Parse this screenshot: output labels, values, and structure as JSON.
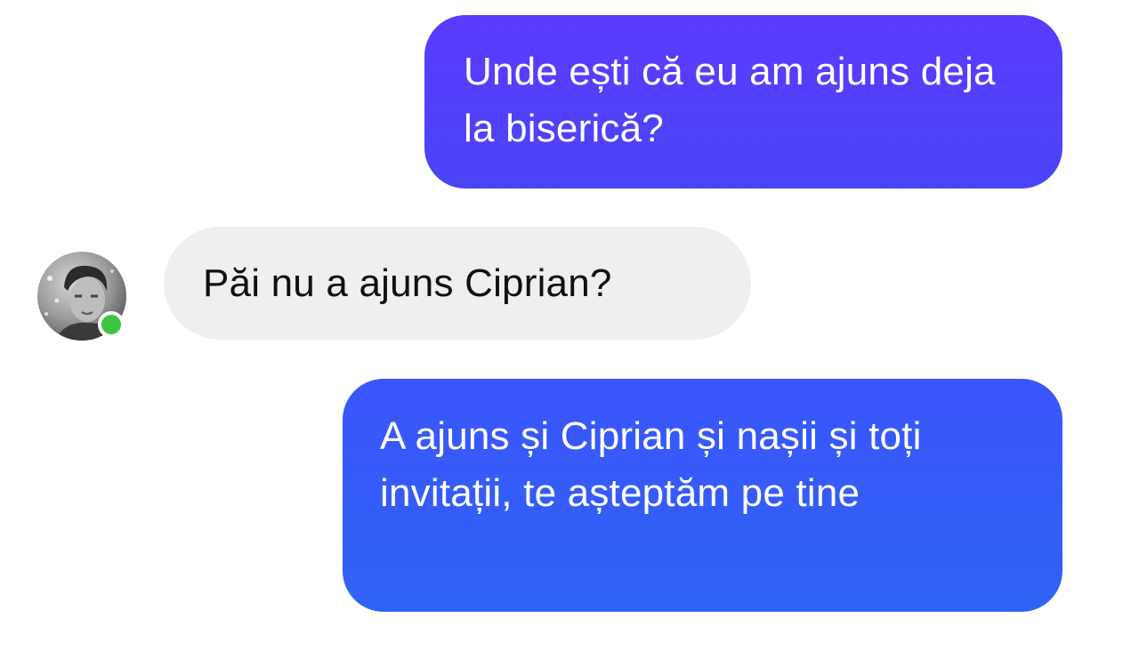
{
  "conversation": {
    "messages": [
      {
        "direction": "outgoing",
        "text": "Unde ești că eu am ajuns deja la biserică?"
      },
      {
        "direction": "incoming",
        "text": "Păi nu a ajuns Ciprian?"
      },
      {
        "direction": "outgoing",
        "text": "A ajuns și Ciprian și nașii și toți invitații, te așteptăm pe tine"
      }
    ],
    "contact": {
      "avatar_icon": "user-photo",
      "status": "online",
      "status_color": "#3ec53e"
    }
  },
  "colors": {
    "outgoing_bubble_top": "#5a3bff",
    "outgoing_bubble_bottom": "#2f63f6",
    "incoming_bubble": "#efefef",
    "background": "#ffffff"
  }
}
